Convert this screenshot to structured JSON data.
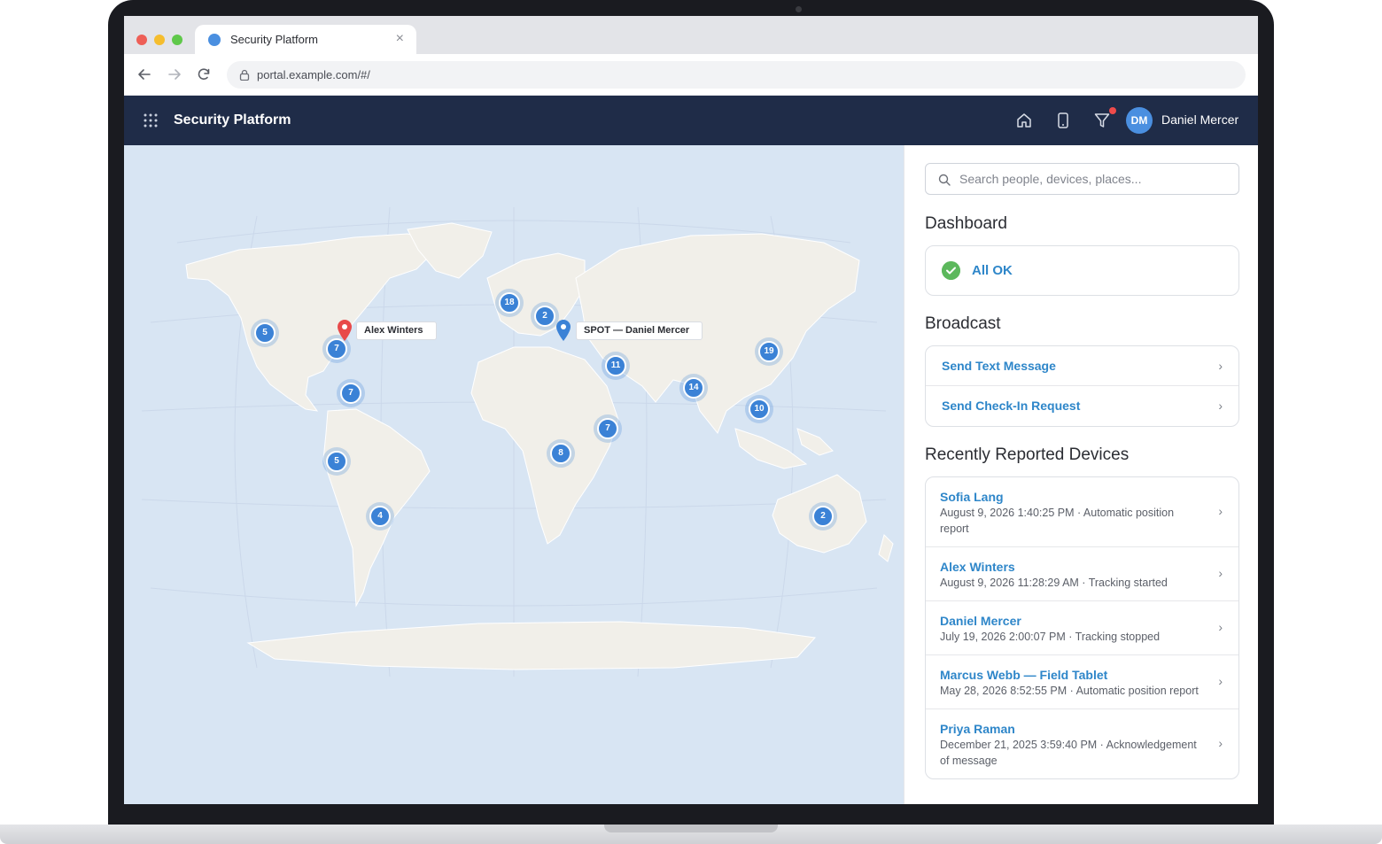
{
  "browser": {
    "tab_title": "Security Platform",
    "url": "portal.example.com/#/"
  },
  "header": {
    "app_title": "Security Platform",
    "user_initials": "DM",
    "user_name": "Daniel Mercer"
  },
  "map": {
    "pins": [
      {
        "label": "Alex Winters",
        "color": "#e84a4a"
      },
      {
        "label": "SPOT — Daniel Mercer",
        "color": "#3b82d6"
      }
    ],
    "clusters": [
      "5",
      "7",
      "7",
      "5",
      "4",
      "18",
      "2",
      "11",
      "7",
      "8",
      "14",
      "19",
      "10",
      "2"
    ]
  },
  "sidebar": {
    "search_placeholder": "Search people, devices, places...",
    "dashboard_title": "Dashboard",
    "status_text": "All OK",
    "broadcast_title": "Broadcast",
    "broadcast_actions": [
      "Send Text Message",
      "Send Check-In Request"
    ],
    "devices_title": "Recently Reported Devices",
    "devices": [
      {
        "name": "Sofia Lang",
        "meta": "August 9, 2026 1:40:25 PM · Automatic position report"
      },
      {
        "name": "Alex Winters",
        "meta": "August 9, 2026 11:28:29 AM · Tracking started"
      },
      {
        "name": "Daniel Mercer",
        "meta": "July 19, 2026 2:00:07 PM · Tracking stopped"
      },
      {
        "name": "Marcus Webb — Field Tablet",
        "meta": "May 28, 2026 8:52:55 PM · Automatic position report"
      },
      {
        "name": "Priya Raman",
        "meta": "December 21, 2025 3:59:40 PM · Acknowledgement of message"
      }
    ]
  },
  "colors": {
    "header_bg": "#1f2c48",
    "accent": "#2e86c9",
    "cluster": "#3b82d6",
    "map_water": "#d8e5f3",
    "map_land": "#f1efe9",
    "ok_green": "#5cb85c"
  }
}
